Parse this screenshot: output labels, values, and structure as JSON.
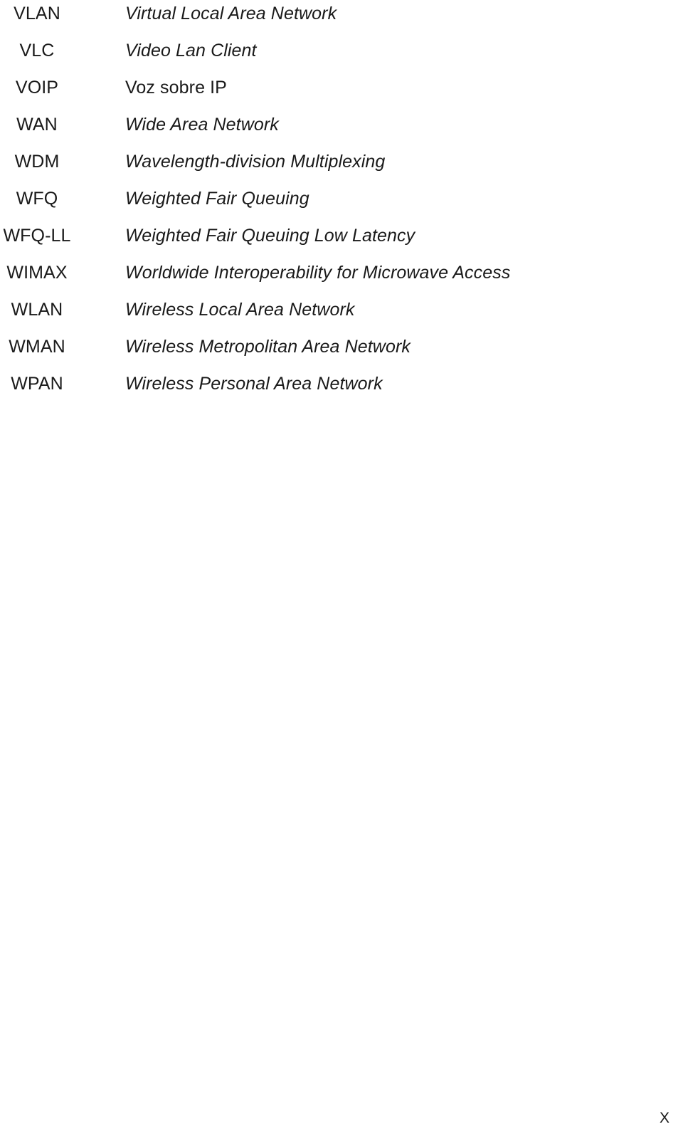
{
  "document": {
    "type": "glossary",
    "page_marker": "X",
    "columns": {
      "abbreviation_header": "",
      "definition_header": ""
    },
    "entries": [
      {
        "abbr": "VLAN",
        "definition": "Virtual Local Area Network",
        "italic": true
      },
      {
        "abbr": "VLC",
        "definition": "Video Lan Client",
        "italic": true
      },
      {
        "abbr": "VOIP",
        "definition": "Voz sobre IP",
        "italic": false
      },
      {
        "abbr": "WAN",
        "definition": "Wide Area Network",
        "italic": true
      },
      {
        "abbr": "WDM",
        "definition": "Wavelength-division Multiplexing",
        "italic": true
      },
      {
        "abbr": "WFQ",
        "definition": "Weighted Fair Queuing",
        "italic": true
      },
      {
        "abbr": "WFQ-LL",
        "definition": "Weighted Fair Queuing Low Latency",
        "italic": true
      },
      {
        "abbr": "WIMAX",
        "definition": "Worldwide Interoperability for Microwave Access",
        "italic": true
      },
      {
        "abbr": "WLAN",
        "definition": "Wireless Local Area Network",
        "italic": true
      },
      {
        "abbr": "WMAN",
        "definition": "Wireless Metropolitan Area Network",
        "italic": true
      },
      {
        "abbr": "WPAN",
        "definition": "Wireless Personal Area Network",
        "italic": true
      }
    ]
  }
}
